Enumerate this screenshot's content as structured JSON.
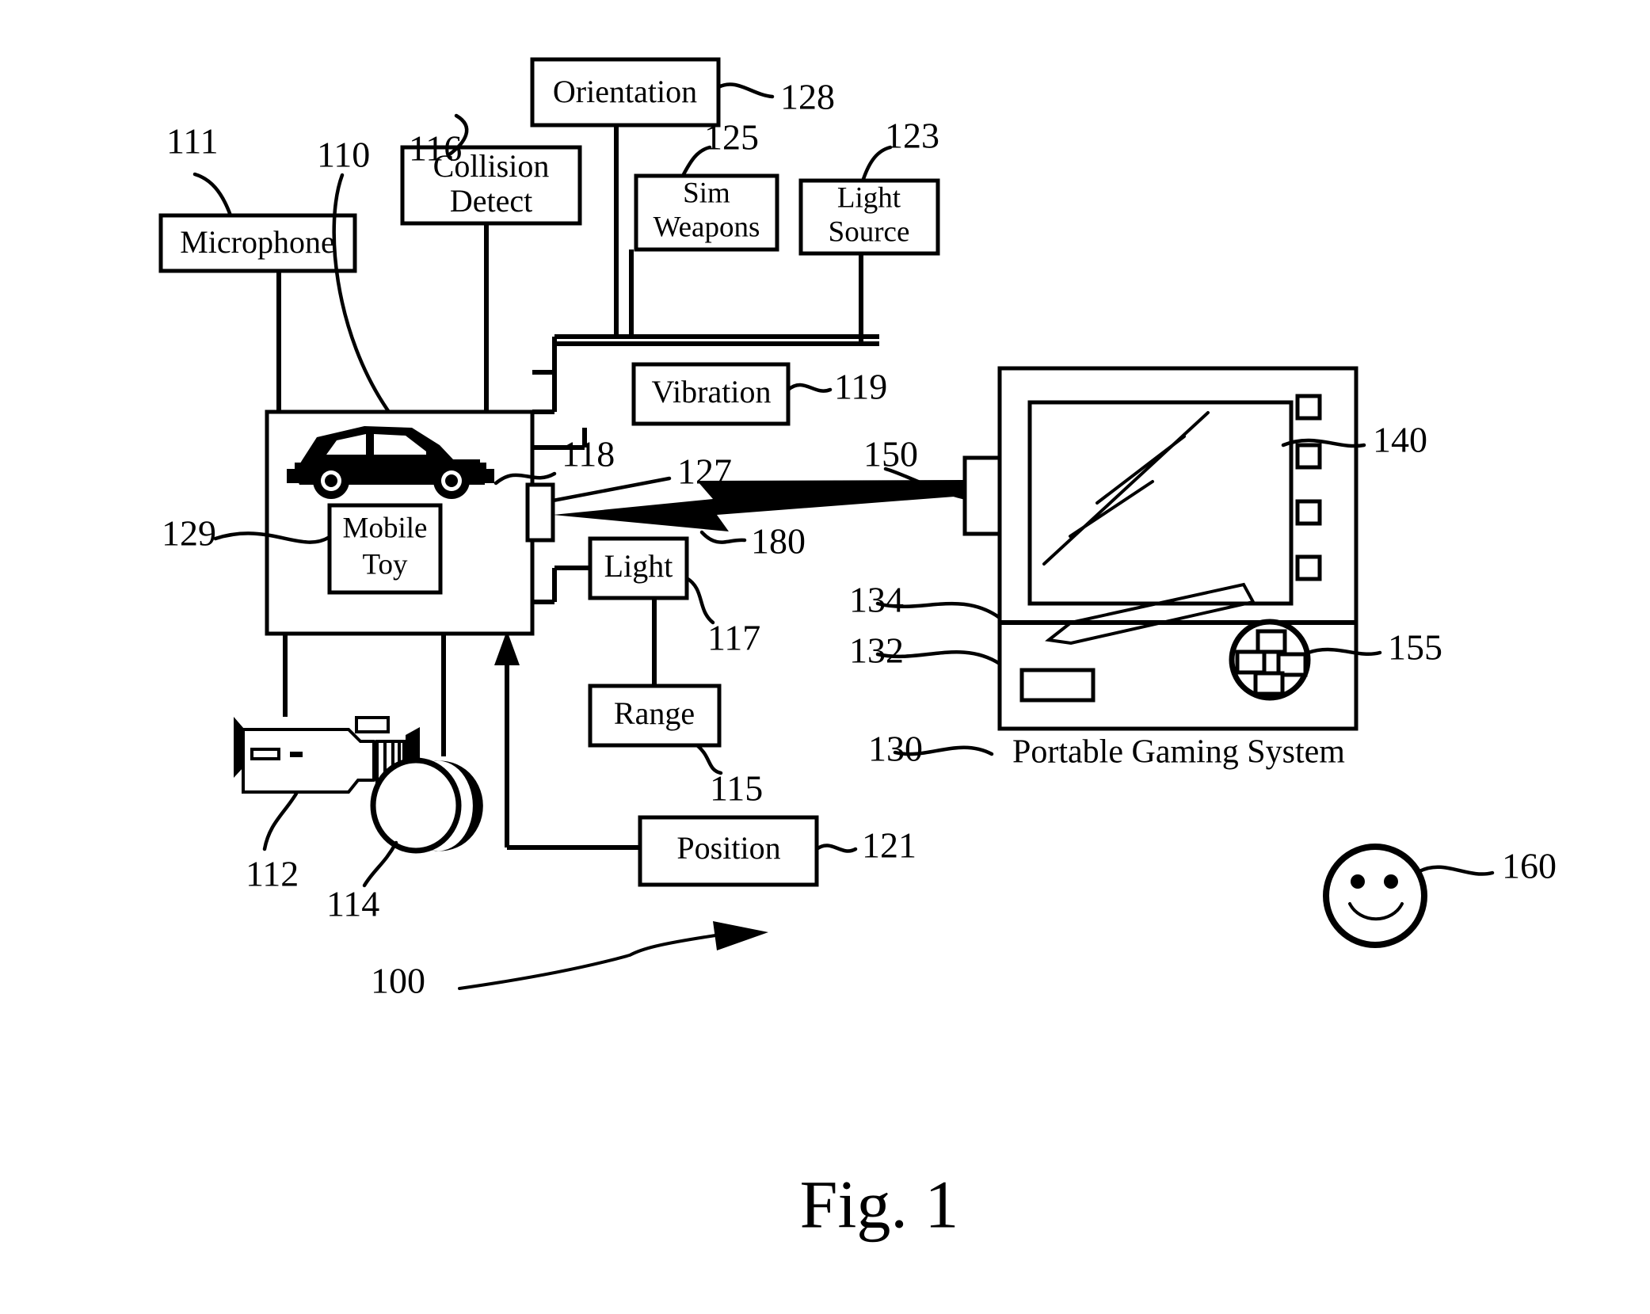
{
  "figure": {
    "title": "Fig. 1",
    "system_caption": "Portable Gaming System"
  },
  "blocks": [
    {
      "id": "orientation",
      "label": "Orientation",
      "ref": "128"
    },
    {
      "id": "collision",
      "label_line1": "Collision",
      "label_line2": "Detect",
      "ref": "116"
    },
    {
      "id": "sim_weapons",
      "label_line1": "Sim",
      "label_line2": "Weapons",
      "ref": "125"
    },
    {
      "id": "light_source",
      "label_line1": "Light",
      "label_line2": "Source",
      "ref": "123"
    },
    {
      "id": "microphone",
      "label": "Microphone",
      "ref": "111"
    },
    {
      "id": "vibration",
      "label": "Vibration",
      "ref": "119"
    },
    {
      "id": "mobile_toy",
      "label_line1": "Mobile",
      "label_line2": "Toy",
      "ref": "129"
    },
    {
      "id": "light",
      "label": "Light",
      "ref": "117"
    },
    {
      "id": "range",
      "label": "Range",
      "ref": "115"
    },
    {
      "id": "position",
      "label": "Position",
      "ref": "121"
    }
  ],
  "labels": {
    "orientation": "Orientation",
    "collision_1": "Collision",
    "collision_2": "Detect",
    "sim_1": "Sim",
    "sim_2": "Weapons",
    "lightsource_1": "Light",
    "lightsource_2": "Source",
    "microphone": "Microphone",
    "vibration": "Vibration",
    "mobiletoy_1": "Mobile",
    "mobiletoy_2": "Toy",
    "light": "Light",
    "range": "Range",
    "position": "Position",
    "gaming_system": "Portable Gaming System",
    "figure_title": "Fig. 1"
  },
  "reference_numerals": {
    "n100": "100",
    "n110": "110",
    "n111": "111",
    "n112": "112",
    "n114": "114",
    "n115": "115",
    "n116": "116",
    "n117": "117",
    "n118": "118",
    "n119": "119",
    "n121": "121",
    "n123": "123",
    "n125": "125",
    "n127": "127",
    "n128": "128",
    "n129": "129",
    "n130": "130",
    "n132": "132",
    "n134": "134",
    "n140": "140",
    "n150": "150",
    "n155": "155",
    "n160": "160",
    "n180": "180"
  },
  "icons": {
    "toy_car": "car-icon",
    "camera": "video-camera-icon",
    "ball": "ball-icon",
    "smiley": "smiley-face-icon",
    "dpad": "dpad-icon",
    "stylus": "stylus-icon",
    "lightning": "lightning-bolt-link-icon",
    "system_arrow": "system-overview-arrow-icon"
  },
  "colors": {
    "ink": "#000000",
    "paper": "#ffffff"
  }
}
